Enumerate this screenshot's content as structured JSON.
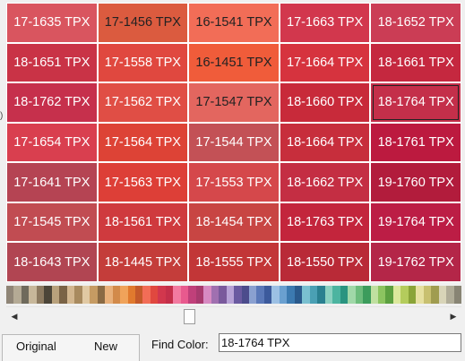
{
  "swatches": [
    [
      {
        "code": "17-1635 TPX",
        "bg": "#D9555F",
        "fg": "#ffffff"
      },
      {
        "code": "17-1456 TPX",
        "bg": "#DB5B3F",
        "fg": "#222222"
      },
      {
        "code": "16-1541 TPX",
        "bg": "#F26D57",
        "fg": "#222222"
      },
      {
        "code": "17-1663 TPX",
        "bg": "#D2374D",
        "fg": "#ffffff"
      },
      {
        "code": "18-1652 TPX",
        "bg": "#CB3D55",
        "fg": "#ffffff"
      }
    ],
    [
      {
        "code": "18-1651 TPX",
        "bg": "#C93346",
        "fg": "#ffffff"
      },
      {
        "code": "17-1558 TPX",
        "bg": "#E0483F",
        "fg": "#ffffff"
      },
      {
        "code": "16-1451 TPX",
        "bg": "#F05C3A",
        "fg": "#222222"
      },
      {
        "code": "17-1664 TPX",
        "bg": "#D6333E",
        "fg": "#ffffff"
      },
      {
        "code": "18-1661 TPX",
        "bg": "#C5283F",
        "fg": "#ffffff"
      }
    ],
    [
      {
        "code": "18-1762 TPX",
        "bg": "#C6304C",
        "fg": "#ffffff"
      },
      {
        "code": "17-1562 TPX",
        "bg": "#E04E45",
        "fg": "#ffffff"
      },
      {
        "code": "17-1547 TPX",
        "bg": "#E3665F",
        "fg": "#222222"
      },
      {
        "code": "18-1660 TPX",
        "bg": "#C82A3A",
        "fg": "#ffffff"
      },
      {
        "code": "18-1764 TPX",
        "bg": "#C42F4A",
        "fg": "#ffffff"
      }
    ],
    [
      {
        "code": "17-1654 TPX",
        "bg": "#D93F4F",
        "fg": "#ffffff"
      },
      {
        "code": "17-1564 TPX",
        "bg": "#DD4336",
        "fg": "#ffffff"
      },
      {
        "code": "17-1544 TPX",
        "bg": "#C35156",
        "fg": "#ffffff"
      },
      {
        "code": "18-1664 TPX",
        "bg": "#C72E3C",
        "fg": "#ffffff"
      },
      {
        "code": "18-1761 TPX",
        "bg": "#BC1A3F",
        "fg": "#ffffff"
      }
    ],
    [
      {
        "code": "17-1641 TPX",
        "bg": "#B54453",
        "fg": "#ffffff"
      },
      {
        "code": "17-1563 TPX",
        "bg": "#DD3F37",
        "fg": "#ffffff"
      },
      {
        "code": "17-1553 TPX",
        "bg": "#D5484B",
        "fg": "#ffffff"
      },
      {
        "code": "18-1662 TPX",
        "bg": "#C42E43",
        "fg": "#ffffff"
      },
      {
        "code": "19-1760 TPX",
        "bg": "#B21C3C",
        "fg": "#ffffff"
      }
    ],
    [
      {
        "code": "17-1545 TPX",
        "bg": "#C14C52",
        "fg": "#ffffff"
      },
      {
        "code": "18-1561 TPX",
        "bg": "#CF3A3E",
        "fg": "#ffffff"
      },
      {
        "code": "18-1454 TPX",
        "bg": "#C84543",
        "fg": "#ffffff"
      },
      {
        "code": "18-1763 TPX",
        "bg": "#C3253C",
        "fg": "#ffffff"
      },
      {
        "code": "19-1764 TPX",
        "bg": "#BC1D45",
        "fg": "#ffffff"
      }
    ],
    [
      {
        "code": "18-1643 TPX",
        "bg": "#B14552",
        "fg": "#ffffff"
      },
      {
        "code": "18-1445 TPX",
        "bg": "#C43D3A",
        "fg": "#ffffff"
      },
      {
        "code": "18-1555 TPX",
        "bg": "#C23637",
        "fg": "#ffffff"
      },
      {
        "code": "18-1550 TPX",
        "bg": "#B92A37",
        "fg": "#ffffff"
      },
      {
        "code": "19-1762 TPX",
        "bg": "#B42648",
        "fg": "#ffffff"
      }
    ]
  ],
  "selected_swatch": "18-1764 TPX",
  "color_strip": [
    "#8f8577",
    "#b4aa95",
    "#6f6a5c",
    "#c7b79a",
    "#8c7a60",
    "#4c4538",
    "#b8a17c",
    "#7a6346",
    "#d2b68f",
    "#a88a5f",
    "#e1c9a3",
    "#c69b63",
    "#8a6a44",
    "#e8b07a",
    "#d28a4a",
    "#f0a35a",
    "#e07a2e",
    "#c45a2a",
    "#f26d57",
    "#e0483f",
    "#d2374d",
    "#c42f4a",
    "#f27aa0",
    "#e85a8e",
    "#c0407a",
    "#a83a6e",
    "#d78ac2",
    "#a070b0",
    "#7a5a9c",
    "#b7a2d6",
    "#6a5aa0",
    "#4c4c8c",
    "#8aa0d0",
    "#5a78b8",
    "#3c5a9c",
    "#9cc0e4",
    "#6aa0d0",
    "#3c7ab0",
    "#2a5a8c",
    "#7ac0d0",
    "#4aa0b4",
    "#2a8090",
    "#8ad0c0",
    "#4cb4a0",
    "#2a9480",
    "#a0d8a8",
    "#6cbc7c",
    "#3c9c5c",
    "#c0e0a0",
    "#8cc460",
    "#5ca040",
    "#dce89c",
    "#b4cc5c",
    "#8aa438",
    "#e6e0a0",
    "#c8c070",
    "#a09c50",
    "#d8d4b8",
    "#b0ac98",
    "#888474"
  ],
  "scrollbar": {
    "left_arrow": "◀",
    "right_arrow": "▶"
  },
  "tabs": {
    "original": "Original",
    "new": "New"
  },
  "find": {
    "label": "Find Color:",
    "value": "18-1764 TPX"
  },
  "edge_glyph": ")"
}
